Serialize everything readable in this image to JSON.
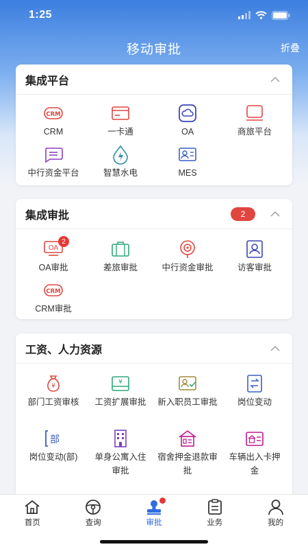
{
  "status": {
    "time": "1:25"
  },
  "header": {
    "title": "移动审批",
    "fold": "折叠"
  },
  "sections": [
    {
      "title": "集成平台",
      "items": [
        {
          "label": "CRM",
          "icon": "crm-icon",
          "color": "#e0463f"
        },
        {
          "label": "一卡通",
          "icon": "card-icon",
          "color": "#e0463f"
        },
        {
          "label": "OA",
          "icon": "cloud-icon",
          "color": "#3a45b7"
        },
        {
          "label": "商旅平台",
          "icon": "monitor-icon",
          "color": "#e0463f"
        },
        {
          "label": "中行资金平台",
          "icon": "chat-list-icon",
          "color": "#8a3fbf"
        },
        {
          "label": "智慧水电",
          "icon": "water-power-icon",
          "color": "#2b8fa8"
        },
        {
          "label": "MES",
          "icon": "id-card-icon",
          "color": "#3a5fbf"
        }
      ]
    },
    {
      "title": "集成审批",
      "pill": "2",
      "items": [
        {
          "label": "OA审批",
          "icon": "oa-stamp-icon",
          "color": "#e0463f",
          "badge": "2"
        },
        {
          "label": "差旅审批",
          "icon": "suitcase-icon",
          "color": "#2fa77a"
        },
        {
          "label": "中行资金审批",
          "icon": "target-icon",
          "color": "#e0463f"
        },
        {
          "label": "访客审批",
          "icon": "visitor-icon",
          "color": "#3a45b7"
        },
        {
          "label": "CRM审批",
          "icon": "crm-icon",
          "color": "#e0463f"
        }
      ]
    },
    {
      "title": "工资、人力资源",
      "items": [
        {
          "label": "部门工资审核",
          "icon": "money-bag-icon",
          "color": "#e0463f"
        },
        {
          "label": "工资扩展审批",
          "icon": "money-card-icon",
          "color": "#2fa77a"
        },
        {
          "label": "新入职员工审批",
          "icon": "new-employee-icon",
          "color": "#a08a3a"
        },
        {
          "label": "岗位变动",
          "icon": "doc-swap-icon",
          "color": "#3a5fbf"
        },
        {
          "label": "岗位变动(部)",
          "icon": "dept-icon",
          "color": "#3a5fbf"
        },
        {
          "label": "单身公寓入住审批",
          "icon": "building-icon",
          "color": "#7b3fbf"
        },
        {
          "label": "宿舍押金退款审批",
          "icon": "house-icon",
          "color": "#c2188c"
        },
        {
          "label": "车辆出入卡押金",
          "icon": "house-card-icon",
          "color": "#c2188c"
        }
      ]
    }
  ],
  "tabbar": [
    {
      "label": "首页",
      "icon": "home-icon"
    },
    {
      "label": "查询",
      "icon": "steering-icon"
    },
    {
      "label": "审批",
      "icon": "approve-stamp-icon",
      "active": true
    },
    {
      "label": "业务",
      "icon": "clipboard-icon"
    },
    {
      "label": "我的",
      "icon": "person-icon"
    }
  ]
}
